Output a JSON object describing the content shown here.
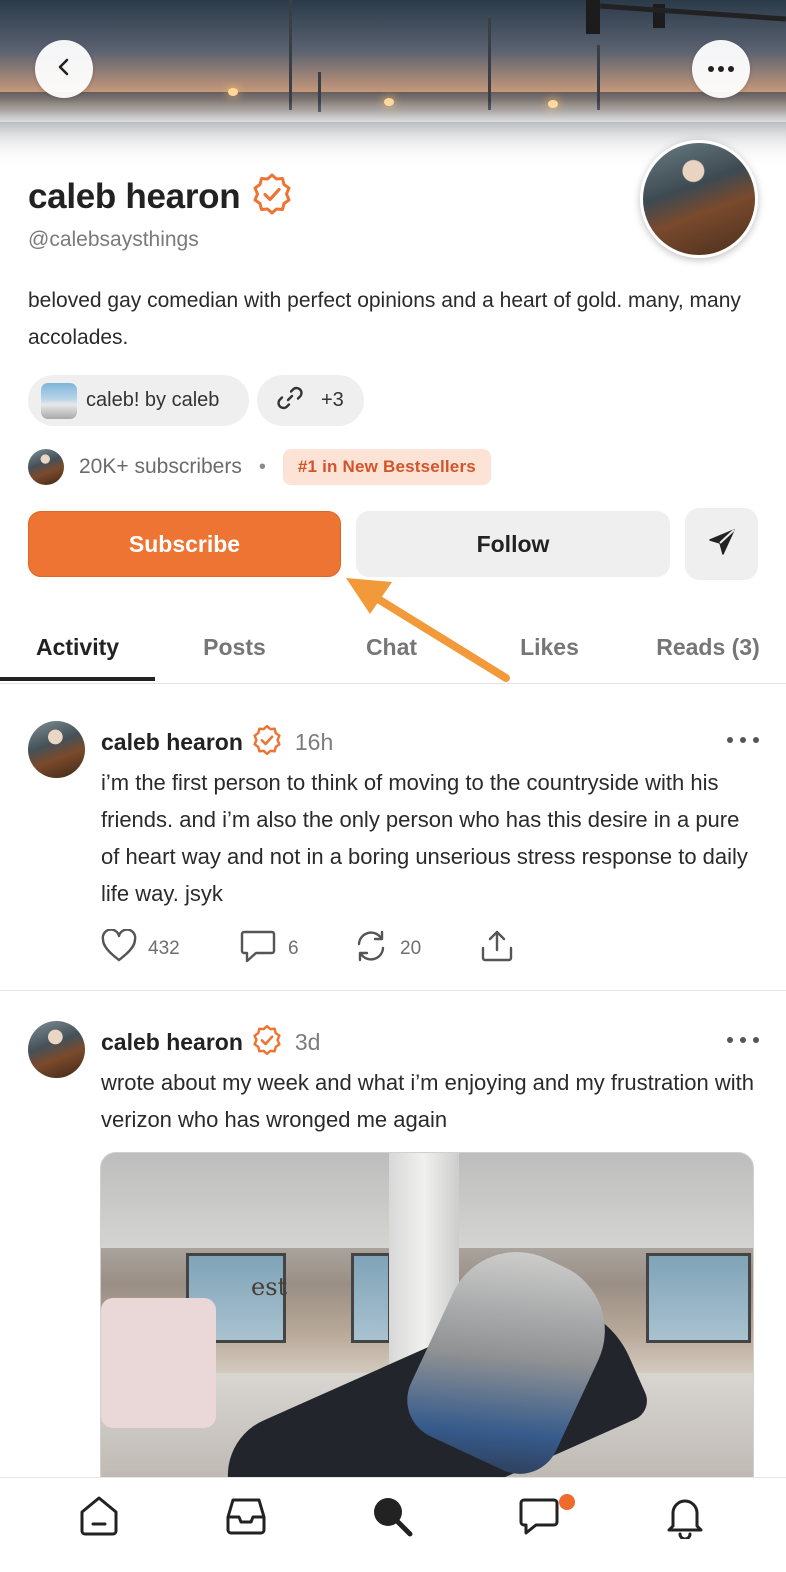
{
  "profile": {
    "name": "caleb hearon",
    "handle": "@calebsaysthings",
    "bio": "beloved gay comedian with perfect opinions and a heart of gold. many, many accolades.",
    "publication": "caleb! by caleb",
    "links_count": "+3",
    "subscribers": "20K+ subscribers",
    "separator": "•",
    "bestseller_badge": "#1 in New Bestsellers"
  },
  "actions": {
    "subscribe_label": "Subscribe",
    "follow_label": "Follow"
  },
  "tabs": [
    {
      "label": "Activity",
      "active": true
    },
    {
      "label": "Posts"
    },
    {
      "label": "Chat"
    },
    {
      "label": "Likes"
    },
    {
      "label": "Reads (3)"
    }
  ],
  "posts": [
    {
      "author": "caleb hearon",
      "time": "16h",
      "text": "i’m the first person to think of moving to the countryside with his friends. and i’m also the only person who has this desire in a pure of heart way and not in a boring unserious stress response to daily life way. jsyk",
      "likes": "432",
      "comments": "6",
      "restacks": "20"
    },
    {
      "author": "caleb hearon",
      "time": "3d",
      "text": "wrote about my week and what i’m enjoying and my frustration with verizon who has wronged me again",
      "photo_sign": "est"
    }
  ],
  "colors": {
    "accent": "#ee7434",
    "verified": "#ee7434",
    "badge_bg": "#fde3d5",
    "badge_text": "#d2542a",
    "annotation_arrow": "#f29a3a"
  },
  "icons": {
    "back": "chevron-left-icon",
    "more": "more-horizontal-icon",
    "verified": "verified-check-icon",
    "link": "link-icon",
    "send": "send-icon",
    "like": "heart-icon",
    "comment": "comment-icon",
    "restack": "restack-icon",
    "share": "share-icon",
    "nav": [
      "home-icon",
      "inbox-icon",
      "search-icon",
      "chat-icon",
      "bell-icon"
    ]
  }
}
